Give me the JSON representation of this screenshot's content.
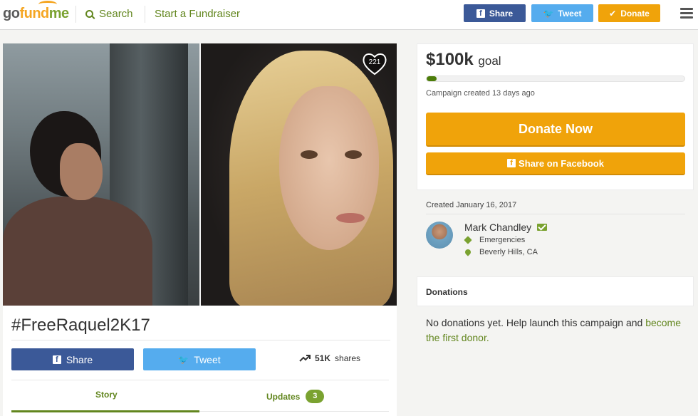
{
  "header": {
    "logo_go": "go",
    "logo_fund": "fund",
    "logo_me": "me",
    "search_label": "Search",
    "start_label": "Start a Fundraiser",
    "share_label": "Share",
    "tweet_label": "Tweet",
    "donate_label": "Donate"
  },
  "campaign": {
    "heart_count": "221",
    "title": "#FreeRaquel2K17",
    "share_label": "Share",
    "tweet_label": "Tweet",
    "shares_count": "51K",
    "shares_suffix": "shares",
    "tabs": {
      "story": "Story",
      "updates": "Updates",
      "updates_count": "3"
    }
  },
  "goal": {
    "amount": "$100k",
    "goal_word": "goal",
    "progress_fraction": 0.04,
    "created_ago": "Campaign created 13 days ago",
    "donate_now": "Donate Now",
    "share_facebook": "Share on Facebook"
  },
  "organizer": {
    "created_date": "Created January 16, 2017",
    "name": "Mark Chandley",
    "category": "Emergencies",
    "location": "Beverly Hills, CA"
  },
  "donations": {
    "title": "Donations",
    "empty_text": "No donations yet. Help launch this campaign and ",
    "empty_link": "become the first donor."
  },
  "colors": {
    "brand_green": "#62861e",
    "donate_orange": "#f0a30a",
    "facebook_blue": "#3b5998",
    "twitter_blue": "#55acee"
  }
}
